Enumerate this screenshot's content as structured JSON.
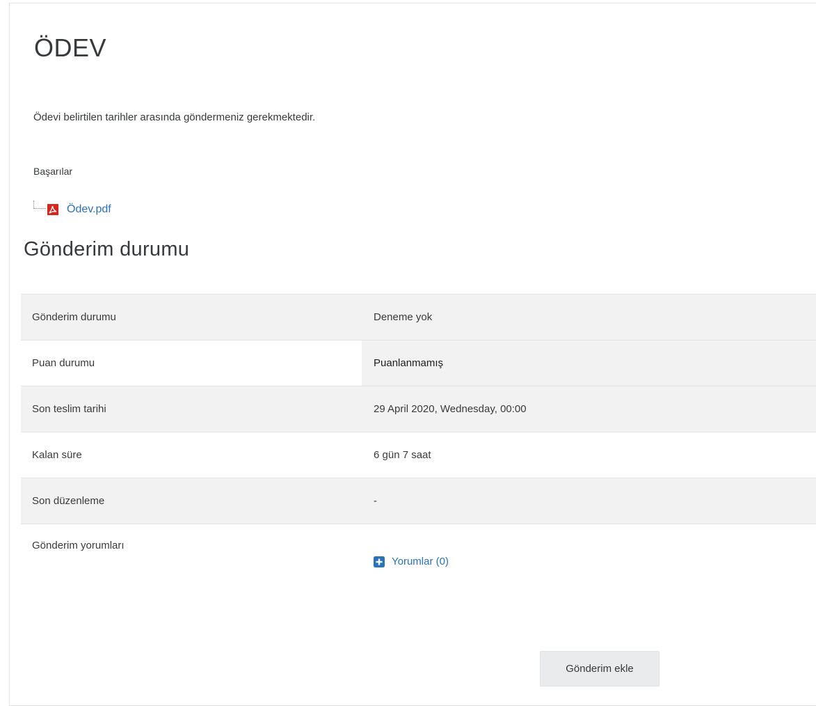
{
  "assignment": {
    "title": "ÖDEV",
    "intro": "Ödevi belirtilen tarihler arasında göndermeniz gerekmektedir."
  },
  "files": {
    "folder_label": "Başarılar",
    "items": [
      {
        "name": "Ödev.pdf",
        "icon": "pdf-icon"
      }
    ]
  },
  "submission_status": {
    "heading": "Gönderim durumu",
    "rows": [
      {
        "label": "Gönderim durumu",
        "value": "Deneme yok"
      },
      {
        "label": "Puan durumu",
        "value": "Puanlanmamış"
      },
      {
        "label": "Son teslim tarihi",
        "value": "29 April 2020, Wednesday, 00:00"
      },
      {
        "label": "Kalan süre",
        "value": "6 gün 7 saat"
      },
      {
        "label": "Son düzenleme",
        "value": "-"
      },
      {
        "label": "Gönderim yorumları",
        "link": "Yorumlar (0)",
        "icon": "plus-square-icon"
      }
    ]
  },
  "actions": {
    "add_submission": "Gönderim ekle"
  },
  "colors": {
    "link": "#2a73b8",
    "row_stripe": "#f2f2f2",
    "pdf_red": "#d7261e",
    "button_bg": "#e9ebec"
  }
}
